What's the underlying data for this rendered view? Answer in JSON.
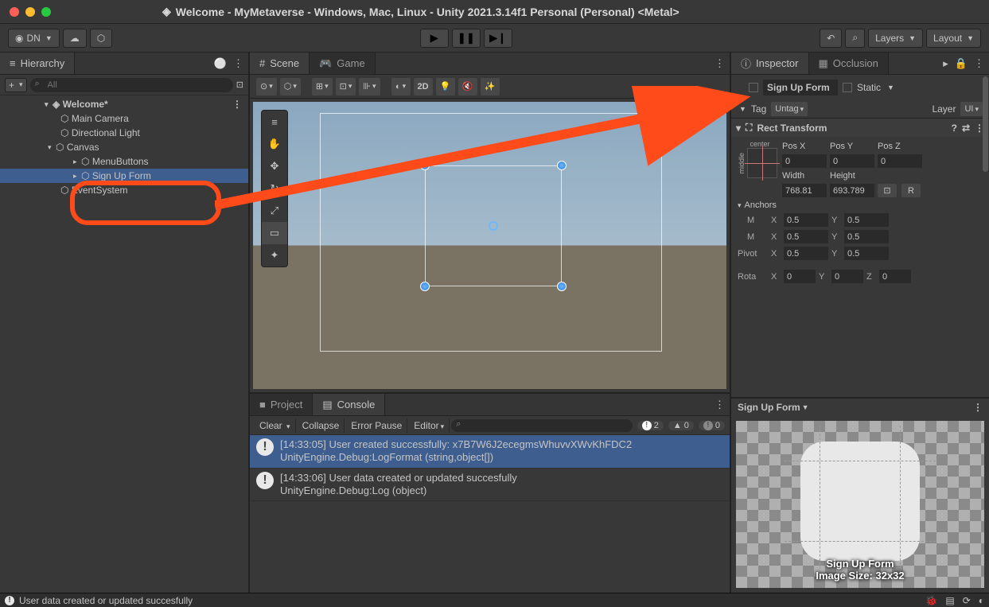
{
  "title": "Welcome - MyMetaverse - Windows, Mac, Linux - Unity 2021.3.14f1 Personal (Personal) <Metal>",
  "toolbar": {
    "account": "DN",
    "layers": "Layers",
    "layout": "Layout"
  },
  "hierarchy": {
    "tab": "Hierarchy",
    "search_placeholder": "All",
    "scene": "Welcome*",
    "items": [
      "Main Camera",
      "Directional Light",
      "Canvas",
      "MenuButtons",
      "Sign Up Form",
      "EventSystem"
    ]
  },
  "scene_tabs": {
    "scene": "Scene",
    "game": "Game",
    "mode_2d": "2D"
  },
  "project_tabs": {
    "project": "Project",
    "console": "Console"
  },
  "console": {
    "clear": "Clear",
    "collapse": "Collapse",
    "error_pause": "Error Pause",
    "editor": "Editor",
    "info_count": "2",
    "warn_count": "0",
    "err_count": "0",
    "entries": [
      {
        "line1": "[14:33:05] User created successfully: x7B7W6J2ecegmsWhuvvXWvKhFDC2",
        "line2": "UnityEngine.Debug:LogFormat (string,object[])"
      },
      {
        "line1": "[14:33:06] User data created or updated succesfully",
        "line2": "UnityEngine.Debug:Log (object)"
      }
    ]
  },
  "inspector": {
    "tab": "Inspector",
    "occlusion_tab": "Occlusion",
    "name": "Sign Up Form",
    "static": "Static",
    "tag_label": "Tag",
    "tag_value": "Untag",
    "layer_label": "Layer",
    "layer_value": "UI",
    "rect_transform": {
      "title": "Rect Transform",
      "anchor_h": "center",
      "anchor_v": "middle",
      "posx_label": "Pos X",
      "posy_label": "Pos Y",
      "posz_label": "Pos Z",
      "posx": "0",
      "posy": "0",
      "posz": "0",
      "width_label": "Width",
      "height_label": "Height",
      "width": "768.81",
      "height": "693.789",
      "anchors_label": "Anchors",
      "min_label": "M",
      "x": "X",
      "y": "Y",
      "z": "Z",
      "anchor_min_x": "0.5",
      "anchor_min_y": "0.5",
      "anchor_max_x": "0.5",
      "anchor_max_y": "0.5",
      "pivot_label": "Pivot",
      "pivot_x": "0.5",
      "pivot_y": "0.5",
      "rotation_label": "Rota",
      "rot_x": "0",
      "rot_y": "0",
      "rot_z": "0",
      "r_btn": "R"
    }
  },
  "preview": {
    "title": "Sign Up Form",
    "label1": "Sign Up Form",
    "label2": "Image Size: 32x32"
  },
  "status": "User data created or updated succesfully"
}
